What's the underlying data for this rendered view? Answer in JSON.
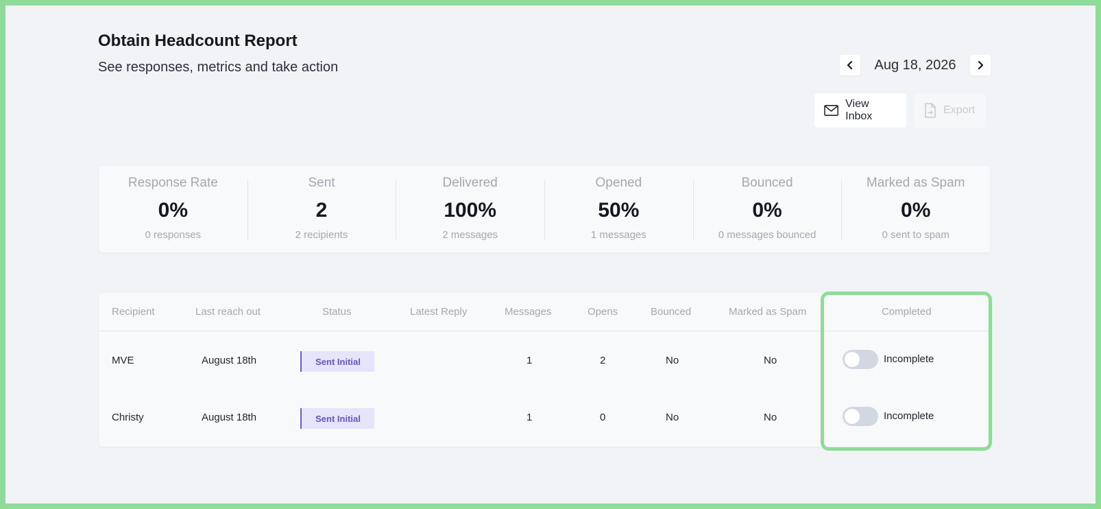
{
  "header": {
    "title": "Obtain Headcount Report",
    "subtitle": "See responses, metrics and take action"
  },
  "date_nav": {
    "date": "Aug 18, 2026",
    "prev_icon": "chevron-left-icon",
    "next_icon": "chevron-right-icon"
  },
  "actions": {
    "view_inbox_label": "View Inbox",
    "view_inbox_icon": "mail-icon",
    "export_label": "Export",
    "export_icon": "file-icon"
  },
  "metrics": [
    {
      "label": "Response Rate",
      "value": "0%",
      "sub": "0 responses"
    },
    {
      "label": "Sent",
      "value": "2",
      "sub": "2 recipients"
    },
    {
      "label": "Delivered",
      "value": "100%",
      "sub": "2 messages"
    },
    {
      "label": "Opened",
      "value": "50%",
      "sub": "1 messages"
    },
    {
      "label": "Bounced",
      "value": "0%",
      "sub": "0 messages bounced"
    },
    {
      "label": "Marked as Spam",
      "value": "0%",
      "sub": "0 sent to spam"
    }
  ],
  "table": {
    "columns": [
      "Recipient",
      "Last reach out",
      "Status",
      "Latest Reply",
      "Messages",
      "Opens",
      "Bounced",
      "Marked as Spam",
      "Completed"
    ],
    "rows": [
      {
        "recipient": "MVE",
        "last_reach_out": "August 18th",
        "status": "Sent Initial",
        "latest_reply": "",
        "messages": "1",
        "opens": "2",
        "bounced": "No",
        "spam": "No",
        "completed_label": "Incomplete",
        "completed": false
      },
      {
        "recipient": "Christy",
        "last_reach_out": "August 18th",
        "status": "Sent Initial",
        "latest_reply": "",
        "messages": "1",
        "opens": "0",
        "bounced": "No",
        "spam": "No",
        "completed_label": "Incomplete",
        "completed": false
      }
    ]
  },
  "colors": {
    "accent_green": "#8fdc9a",
    "status_purple": "#6353d0",
    "status_bg": "#e6e4fb"
  }
}
